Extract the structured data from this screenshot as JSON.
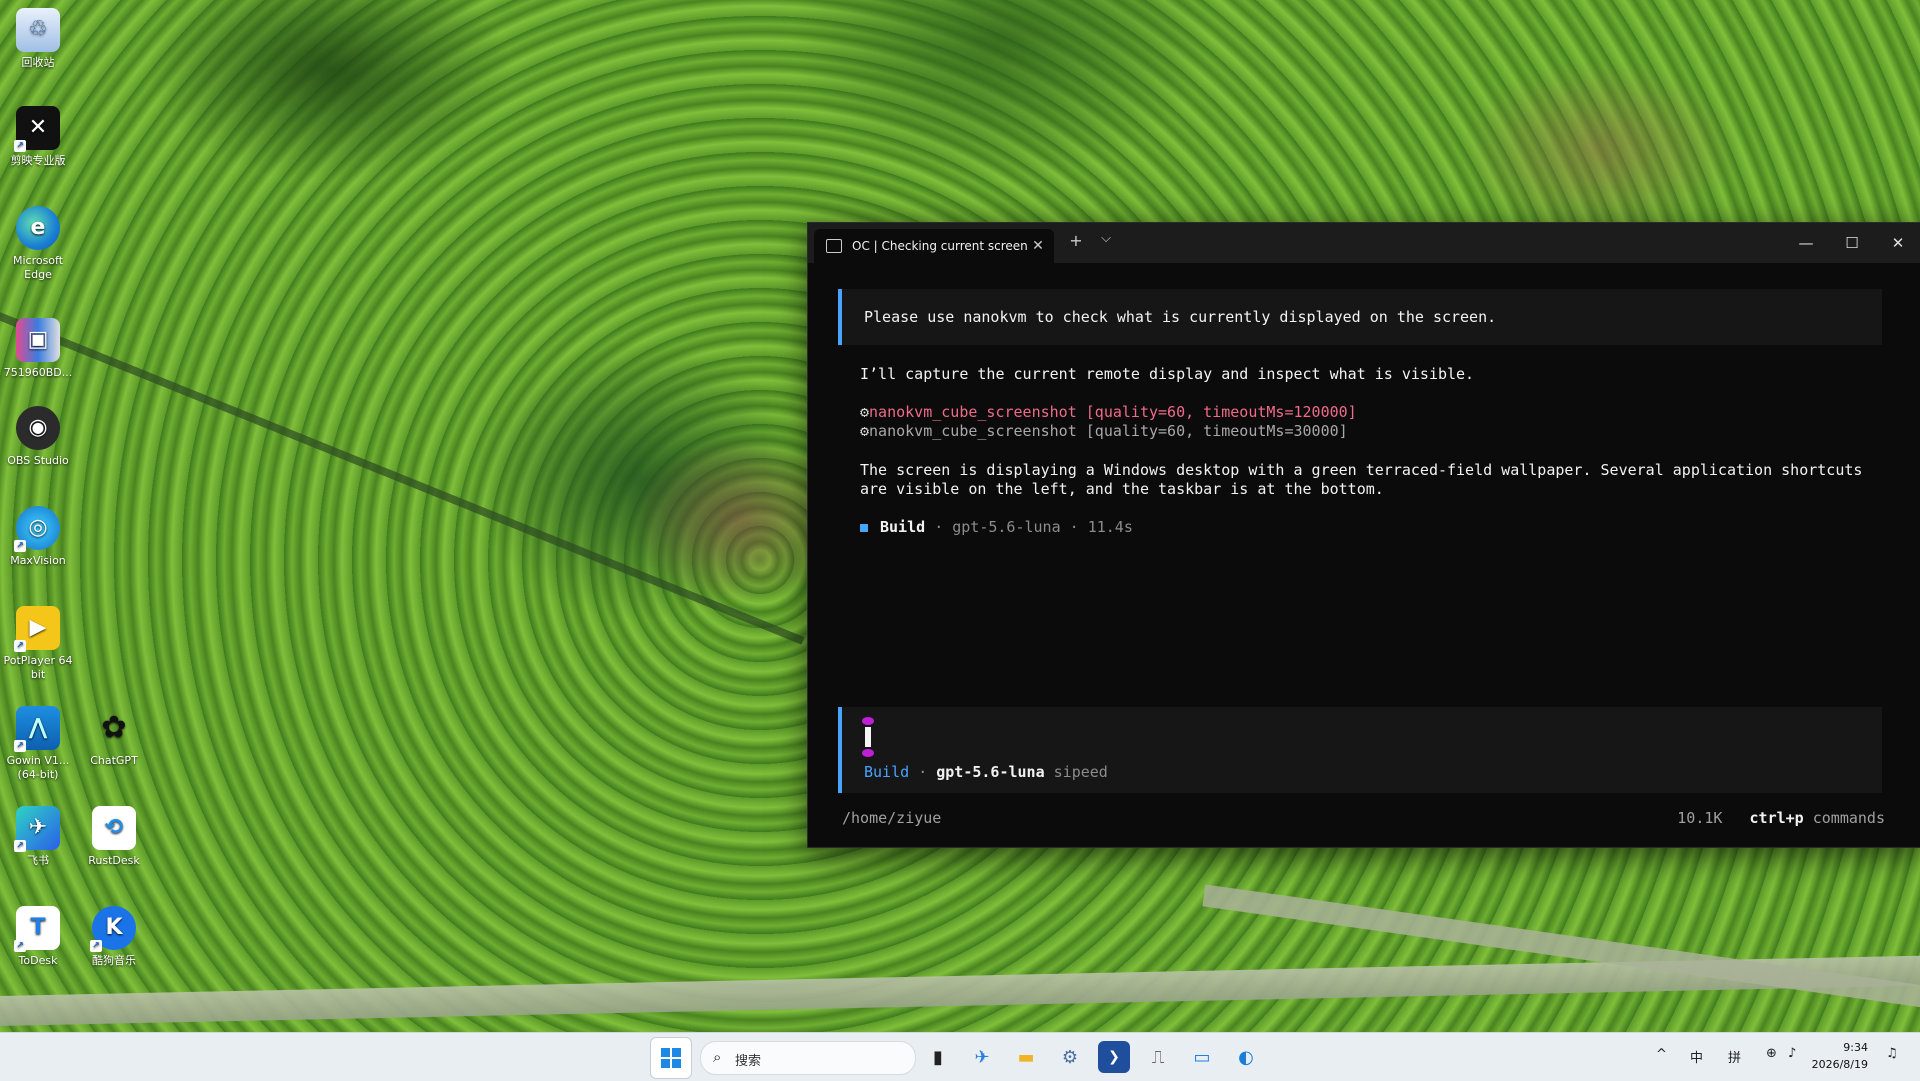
{
  "desktop": {
    "icons": [
      {
        "label": "回收站"
      },
      {
        "label": "剪映专业版"
      },
      {
        "label": "Microsoft Edge"
      },
      {
        "label": "751960BD..."
      },
      {
        "label": "OBS Studio"
      },
      {
        "label": "MaxVision"
      },
      {
        "label": "PotPlayer 64 bit"
      },
      {
        "label": "Gowin V1... (64-bit)"
      },
      {
        "label": "ChatGPT"
      },
      {
        "label": "飞书"
      },
      {
        "label": "RustDesk"
      },
      {
        "label": "ToDesk"
      },
      {
        "label": "酷狗音乐"
      }
    ]
  },
  "terminal": {
    "tab_title": "OC | Checking current screen c",
    "tab_close": "✕",
    "new_tab": "+",
    "tab_dropdown": "⌵",
    "minimize": "—",
    "maximize": "☐",
    "close": "✕",
    "user_message": "Please use nanokvm to check what is currently displayed on the screen.",
    "assistant_intro": "I’ll capture the current remote display and inspect what is visible.",
    "tool_calls": [
      {
        "name": "nanokvm_cube_screenshot",
        "args": "[quality=60, timeoutMs=120000]"
      },
      {
        "name": "nanokvm_cube_screenshot",
        "args": "[quality=60, timeoutMs=30000]"
      }
    ],
    "assistant_result_line1": "The screen is displaying a Windows desktop with a green terraced-field wallpaper. Several application shortcuts",
    "assistant_result_line2": "are visible on the left, and the taskbar is at the bottom.",
    "summary": {
      "mode": "Build",
      "sep": "·",
      "model": "gpt-5.6-luna",
      "duration": "11.4s"
    },
    "input_status": {
      "mode": "Build",
      "sep": "·",
      "model": "gpt-5.6-luna",
      "provider": "sipeed"
    },
    "cwd": "/home/ziyue",
    "tokens": "10.1K",
    "shortcut_key": "ctrl+p",
    "shortcut_label": "commands"
  },
  "taskbar": {
    "search_placeholder": "搜索",
    "tray": {
      "lang": "中",
      "ime": "拼",
      "chevron": "^"
    },
    "time": "9:34",
    "date": "2026/8/19"
  },
  "colors": {
    "accent_blue": "#4aa3ff",
    "tool_active": "#f06a8a",
    "caret_magenta": "#c11fd6"
  }
}
